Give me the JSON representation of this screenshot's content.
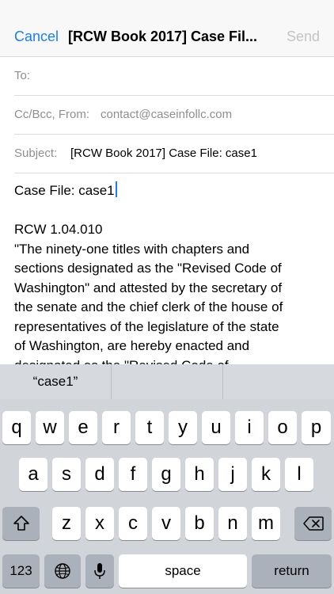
{
  "nav": {
    "cancel_label": "Cancel",
    "title": "[RCW Book 2017] Case Fil...",
    "send_label": "Send"
  },
  "fields": {
    "to_label": "To:",
    "to_value": "",
    "cc_label": "Cc/Bcc, From:",
    "from_value": "contact@caseinfollc.com",
    "subject_label": "Subject:",
    "subject_value": "[RCW Book 2017] Case File: case1"
  },
  "body": {
    "first_line": "Case File: case1",
    "lines": [
      "RCW 1.04.010",
      "\"The ninety-one titles with chapters and",
      "sections designated as the \"Revised Code of",
      "Washington\" and attested by the secretary of",
      "the senate and the chief clerk of the house of",
      "representatives of the legislature of the state",
      "of Washington, are hereby enacted and",
      "designated as the \"Revised Code of"
    ]
  },
  "keyboard": {
    "suggestions": [
      "“case1”",
      "",
      ""
    ],
    "row1": [
      "q",
      "w",
      "e",
      "r",
      "t",
      "y",
      "u",
      "i",
      "o",
      "p"
    ],
    "row2": [
      "a",
      "s",
      "d",
      "f",
      "g",
      "h",
      "j",
      "k",
      "l"
    ],
    "row3": [
      "z",
      "x",
      "c",
      "v",
      "b",
      "n",
      "m"
    ],
    "numbers_label": "123",
    "space_label": "space",
    "return_label": "return",
    "icons": {
      "shift": "shift-icon",
      "delete": "backspace-icon",
      "globe": "globe-icon",
      "mic": "microphone-icon"
    }
  },
  "colors": {
    "accent": "#1a7cfa",
    "disabled": "#c4c4c8",
    "label_gray": "#8e8e93",
    "keyboard_bg": "#d1d4d9",
    "dark_key": "#abb1ba"
  }
}
